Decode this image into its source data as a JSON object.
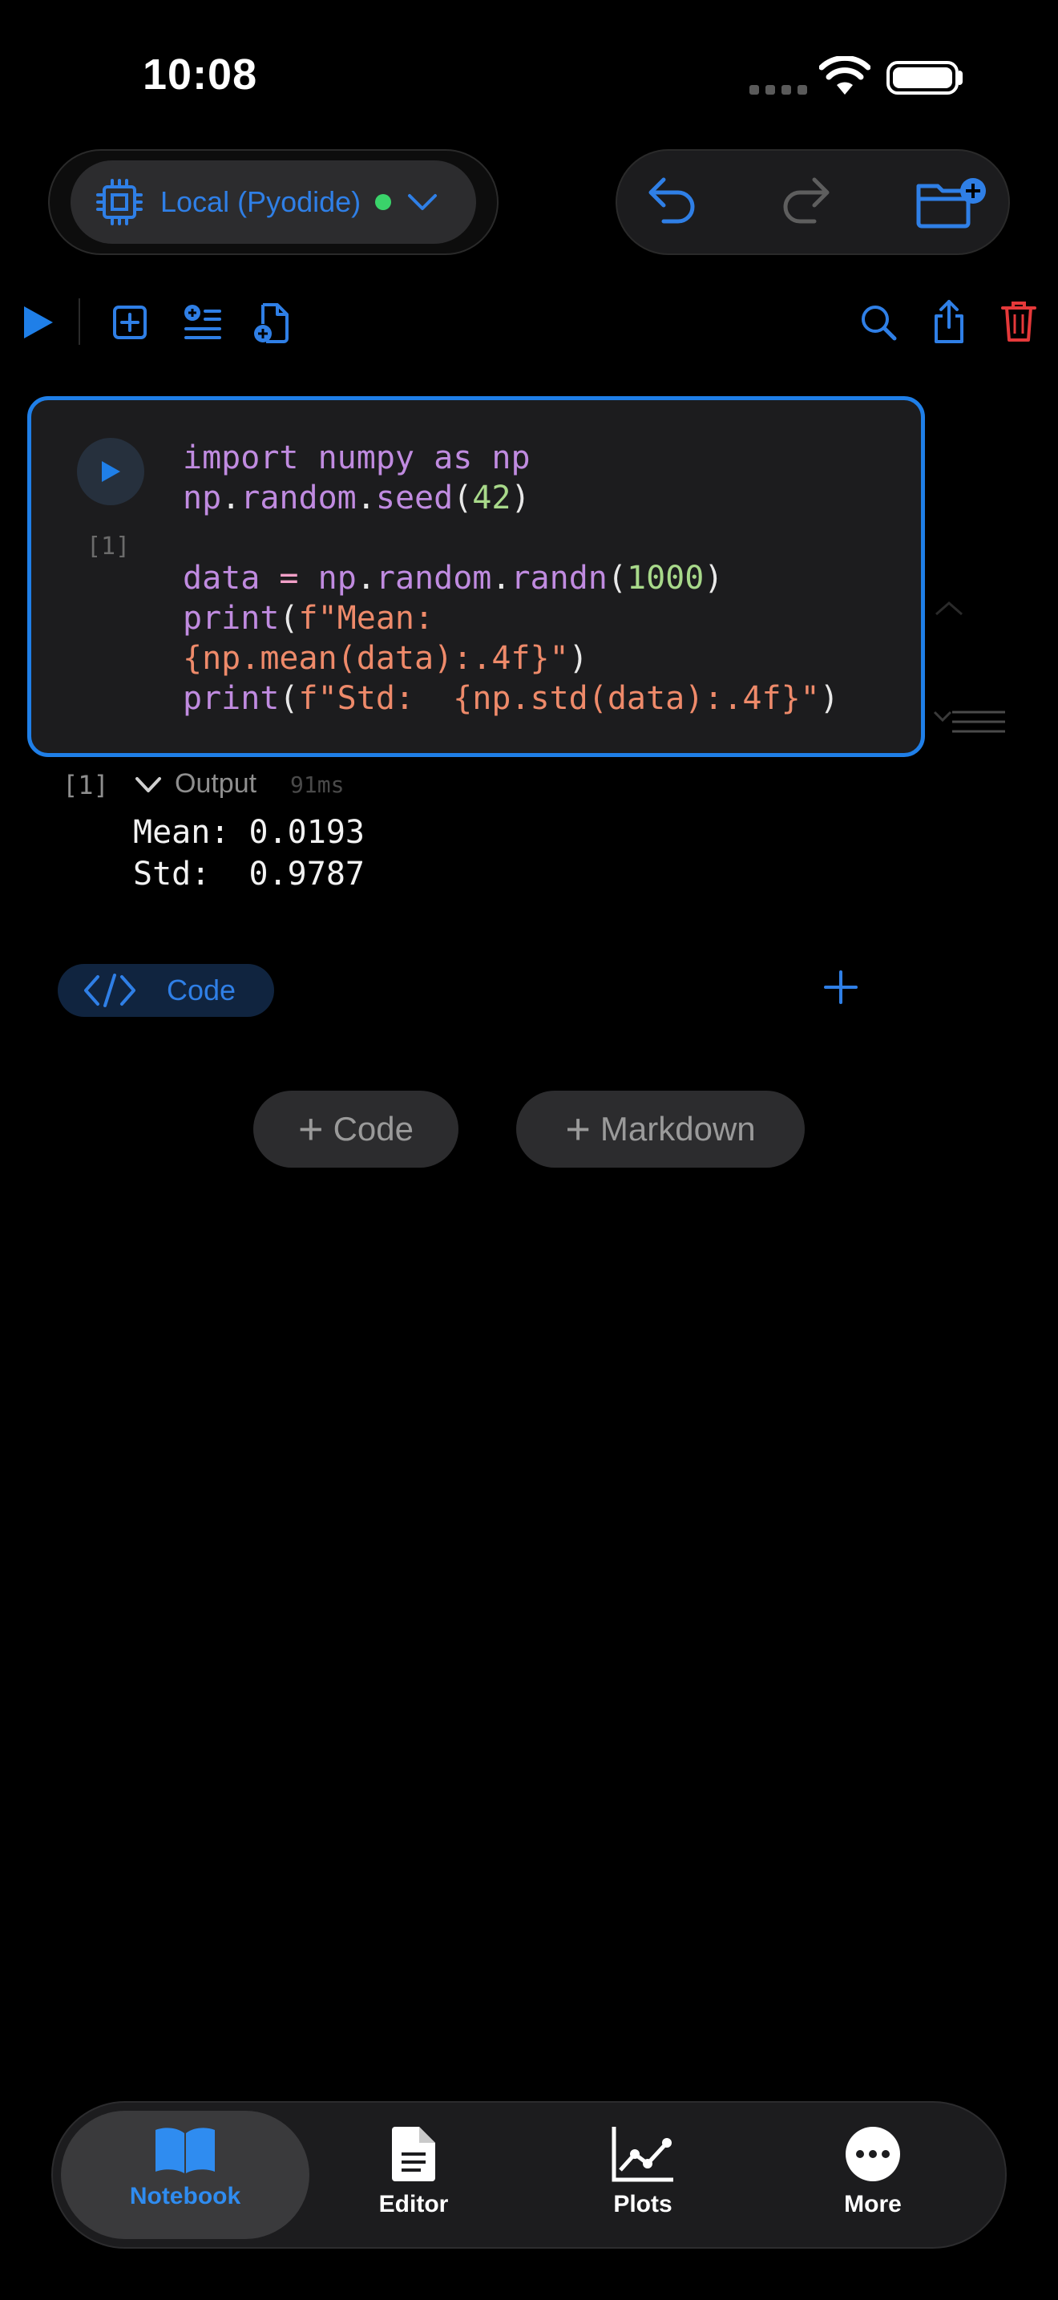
{
  "status_bar": {
    "time": "10:08"
  },
  "kernel": {
    "name": "Local (Pyodide)",
    "status_color": "#3ad36a"
  },
  "cell": {
    "execution_count": "[1]",
    "code_lines": [
      "import numpy as np",
      "np.random.seed(42)",
      "",
      "data = np.random.randn(1000)",
      "print(f\"Mean:",
      "{np.mean(data):.4f}\")",
      "print(f\"Std:  {np.std(data):.4f}\")"
    ]
  },
  "output": {
    "count": "[1]",
    "label": "Output",
    "duration": "91ms",
    "text": "Mean: 0.0193\nStd:  0.9787"
  },
  "cell_type_chip": {
    "label": "Code"
  },
  "add_buttons": {
    "code": "Code",
    "markdown": "Markdown"
  },
  "tabs": [
    {
      "label": "Notebook",
      "icon": "book-icon",
      "active": true
    },
    {
      "label": "Editor",
      "icon": "document-icon",
      "active": false
    },
    {
      "label": "Plots",
      "icon": "chart-icon",
      "active": false
    },
    {
      "label": "More",
      "icon": "ellipsis-icon",
      "active": false
    }
  ],
  "colors": {
    "accent": "#1f7fe8",
    "danger": "#e5393a",
    "background": "#000000"
  }
}
